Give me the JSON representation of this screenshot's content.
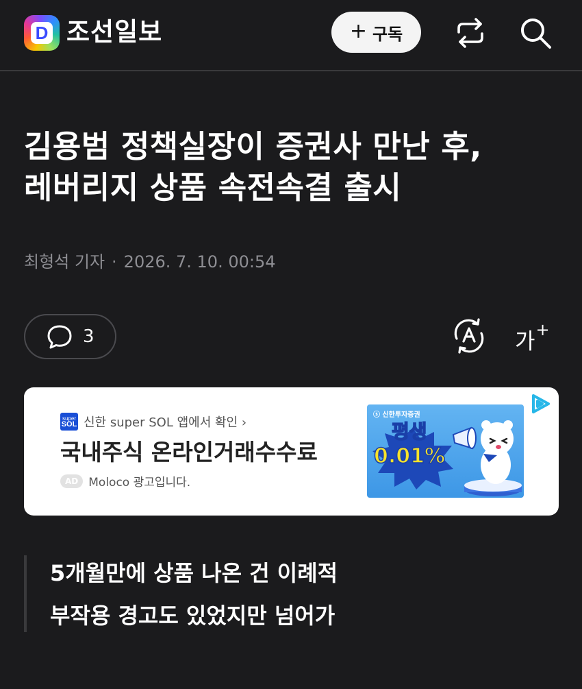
{
  "header": {
    "logo_letter": "D",
    "brand": "조선일보",
    "subscribe_plus": "+",
    "subscribe_label": "구독",
    "share_icon": "share-icon",
    "search_icon": "search-icon"
  },
  "article": {
    "headline_line1": "김용범 정책실장이 증권사 만난 후,",
    "headline_line2": "레버리지 상품 속전속결 출시",
    "author": "최형석 기자",
    "separator": "·",
    "date": "2026. 7. 10. 00:54",
    "subheads": [
      "5개월만에 상품 나온 건 이례적",
      "부작용 경고도 있었지만 넘어가"
    ]
  },
  "toolbar": {
    "comment_count": "3",
    "font_label": "가",
    "font_plus": "+"
  },
  "ad": {
    "source_logo_top": "super",
    "source_logo_bottom": "SOL",
    "source": "신한 super SOL 앱에서 확인 ›",
    "title": "국내주식 온라인거래수수료",
    "badge": "AD",
    "advertiser": "Moloco 광고입니다.",
    "image_brand": "ⓢ 신한투자증권",
    "image_headline": "평생",
    "image_rate": "0.01%"
  },
  "colors": {
    "background": "#1b1b1d",
    "text": "#ffffff",
    "muted": "#8e8e93",
    "ad_background": "#ffffff",
    "adchoices": "#27b7e8"
  }
}
